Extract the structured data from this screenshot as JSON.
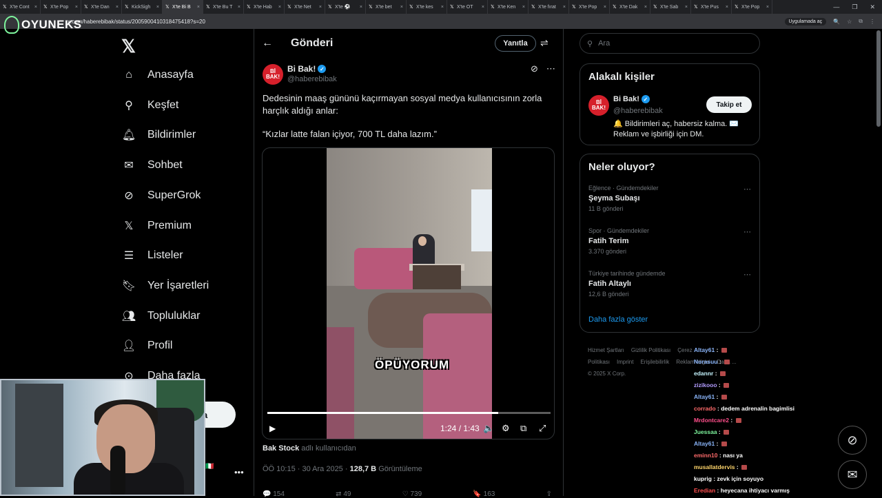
{
  "browser": {
    "tabs": [
      {
        "label": "X'te Cont"
      },
      {
        "label": "X'te Pop"
      },
      {
        "label": "X'te Dan"
      },
      {
        "label": "KickSigh"
      },
      {
        "label": "X'te Bi B",
        "active": true
      },
      {
        "label": "X'te Bu T"
      },
      {
        "label": "X'te Hab"
      },
      {
        "label": "X'te Net"
      },
      {
        "label": "X'te ⚽"
      },
      {
        "label": "X'te bet"
      },
      {
        "label": "X'te kes"
      },
      {
        "label": "X'te OT"
      },
      {
        "label": "X'te Ken"
      },
      {
        "label": "X'te fırat"
      },
      {
        "label": "X'te Pop"
      },
      {
        "label": "X'te Dak"
      },
      {
        "label": "X'te Sab"
      },
      {
        "label": "X'te Pus"
      },
      {
        "label": "X'te Pop"
      }
    ],
    "url": "x.com/haberebibak/status/2005900410318475418?s=20",
    "app_button": "Uygulamada aç"
  },
  "overlay_logo": "OYUNEKS",
  "nav": {
    "items": [
      {
        "label": "Anasayfa",
        "icon": "home-icon"
      },
      {
        "label": "Keşfet",
        "icon": "search-icon"
      },
      {
        "label": "Bildirimler",
        "icon": "bell-icon"
      },
      {
        "label": "Sohbet",
        "icon": "mail-icon"
      },
      {
        "label": "SuperGrok",
        "icon": "grok-icon"
      },
      {
        "label": "Premium",
        "icon": "x-icon"
      },
      {
        "label": "Listeler",
        "icon": "list-icon"
      },
      {
        "label": "Yer İşaretleri",
        "icon": "bookmark-icon"
      },
      {
        "label": "Topluluklar",
        "icon": "community-icon"
      },
      {
        "label": "Profil",
        "icon": "person-icon"
      },
      {
        "label": "Daha fazla",
        "icon": "more-circle-icon"
      }
    ],
    "post_button_partial": "a"
  },
  "header": {
    "title": "Gönderi",
    "reply_label": "Yanıtla"
  },
  "post": {
    "author_name": "Bi Bak!",
    "author_handle": "@haberebibak",
    "avatar_text": "Bİ BAK!",
    "text": "Dedesinin maaş gününü kaçırmayan sosyal medya kullanıcısının zorla harçlık aldığı anlar:",
    "quote": "“Kızlar latte falan içiyor, 700 TL daha lazım.”",
    "video": {
      "caption": "ÖPÜYORUM",
      "current_time": "1:24",
      "duration": "1:43",
      "progress": 0.815
    },
    "from_user": "Bak Stock",
    "from_suffix": "adlı kullanıcıdan",
    "time": "ÖÖ 10:15 · 30 Ara 2025 ·",
    "views": "128,7 B",
    "views_label": "Görüntüleme",
    "actions": [
      "154",
      "49",
      "739",
      "163"
    ]
  },
  "search": {
    "placeholder": "Ara"
  },
  "related": {
    "title": "Alakalı kişiler",
    "name": "Bi Bak!",
    "handle": "@haberebibak",
    "follow_label": "Takip et",
    "bio": "🔔 Bildirimleri aç, habersiz kalma. ✉️ Reklam ve işbirliği için DM."
  },
  "trends": {
    "title": "Neler oluyor?",
    "items": [
      {
        "category": "Eğlence · Gündemdekiler",
        "name": "Şeyma Subaşı",
        "count": "11 B gönderi"
      },
      {
        "category": "Spor · Gündemdekiler",
        "name": "Fatih Terim",
        "count": "3.370 gönderi"
      },
      {
        "category": "Türkiye tarihinde gündemde",
        "name": "Fatih Altaylı",
        "count": "12,6 B gönderi"
      }
    ],
    "show_more": "Daha fazla göster"
  },
  "footer": {
    "links": [
      "Hizmet Şartları",
      "Gizlilik Politikası",
      "Çerez Politikası",
      "Imprint",
      "Erişilebilirlik",
      "Reklam bilgisi",
      "Daha ..."
    ],
    "copyright": "© 2025 X Corp."
  },
  "chat": [
    {
      "user": "Altay61",
      "text": "",
      "color": "#8ab4f8"
    },
    {
      "user": "Norasuu",
      "text": "",
      "color": "#8ab4f8"
    },
    {
      "user": "edannr",
      "text": "",
      "color": "#c6f5ff"
    },
    {
      "user": "zizikooo",
      "text": "",
      "color": "#b39cff"
    },
    {
      "user": "Altay61",
      "text": "",
      "color": "#8ab4f8"
    },
    {
      "user": "corrado",
      "text": "dedem adrenalin bagimlisi",
      "color": "#ff6b6b"
    },
    {
      "user": "Mrdontcare2",
      "text": "",
      "color": "#ff4f8b"
    },
    {
      "user": "Juessaa",
      "text": "",
      "color": "#7ef59d"
    },
    {
      "user": "Altay61",
      "text": "",
      "color": "#8ab4f8"
    },
    {
      "user": "eminn10",
      "text": "nası ya",
      "color": "#ff6b6b"
    },
    {
      "user": "musallatdervis",
      "text": "",
      "color": "#ffd56b"
    },
    {
      "user": "kuprig",
      "text": "zevk için soyuyo",
      "color": "#ffffff"
    },
    {
      "user": "Eredian",
      "text": "heyecana ihtiyacı varmış",
      "color": "#ff4f4f"
    }
  ]
}
